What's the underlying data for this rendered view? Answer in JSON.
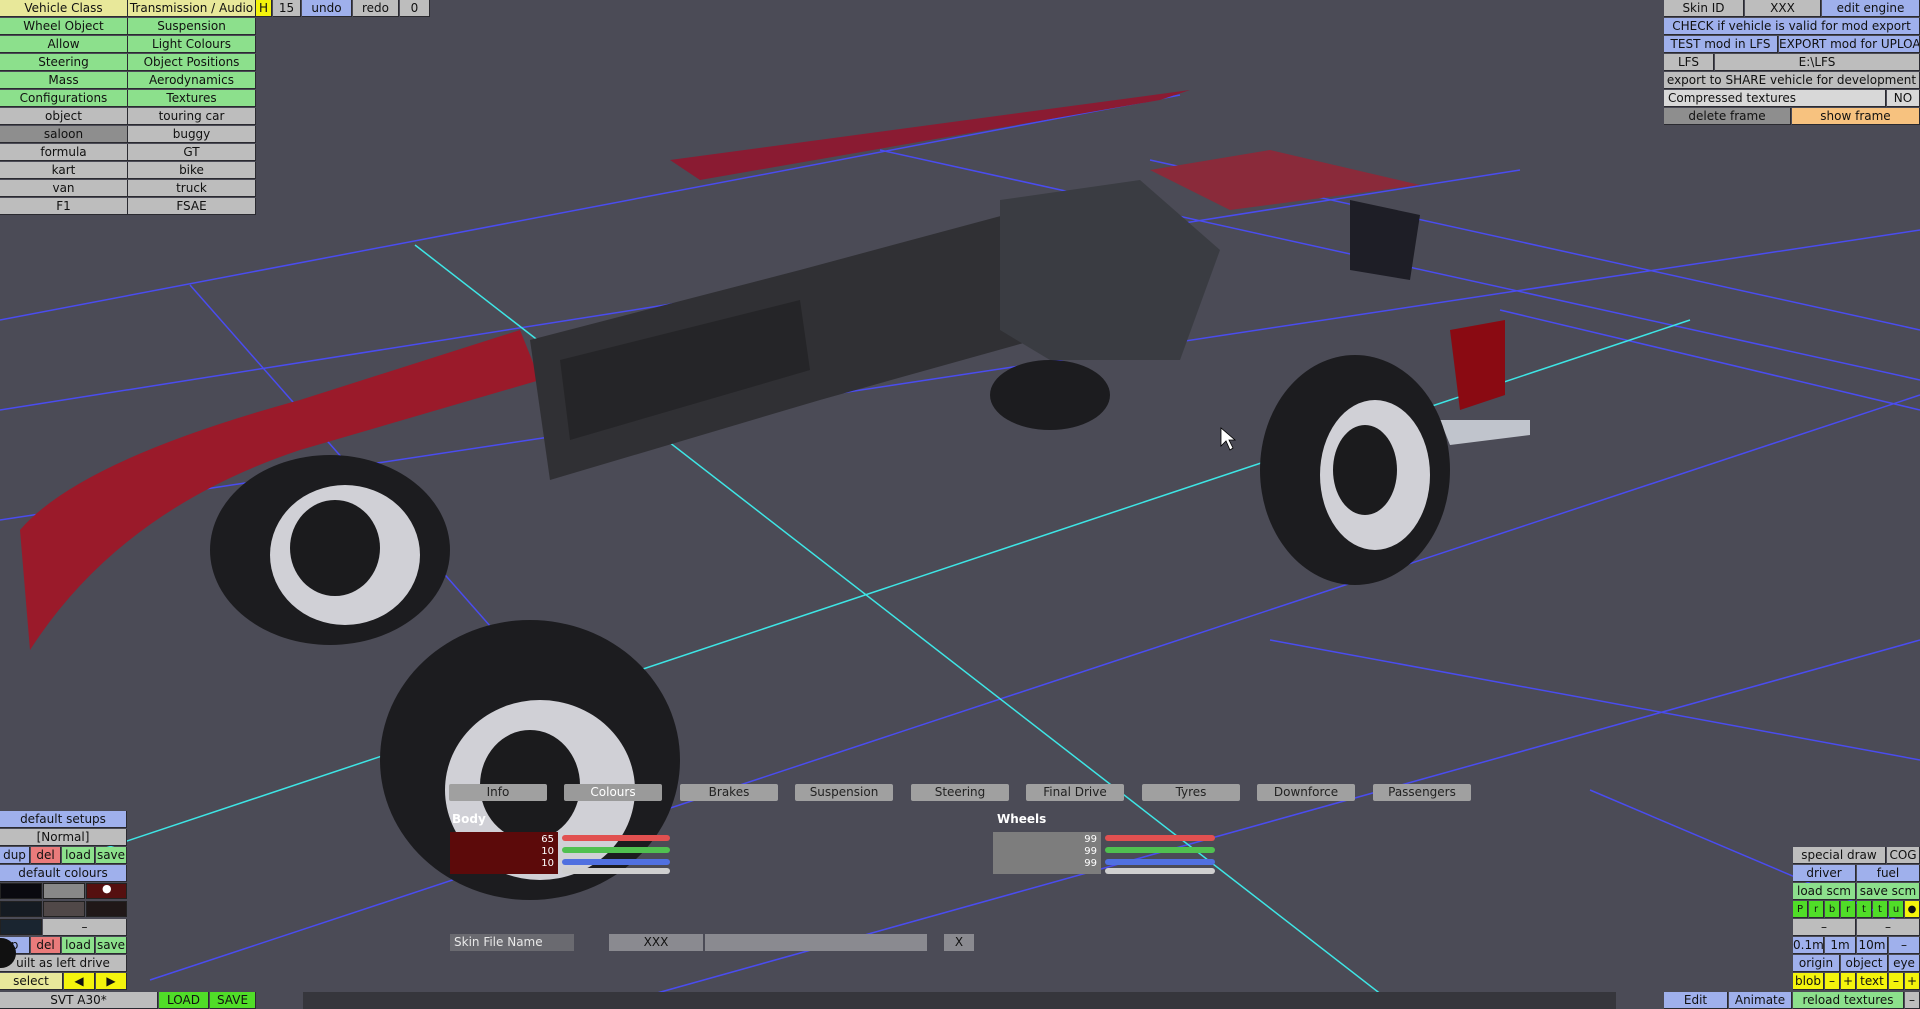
{
  "top_left_menu": {
    "col1": [
      "Vehicle Class",
      "Wheel Object",
      "Allow",
      "Steering",
      "Mass",
      "Configurations",
      "object",
      "saloon",
      "formula",
      "kart",
      "van",
      "F1"
    ],
    "col2": [
      "Transmission / Audio",
      "Suspension",
      "Light Colours",
      "Object Positions",
      "Aerodynamics",
      "Textures",
      "touring car",
      "buggy",
      "GT",
      "bike",
      "truck",
      "FSAE"
    ]
  },
  "top_toolbar": {
    "h_label": "H",
    "number": "15",
    "undo": "undo",
    "redo": "redo",
    "zero": "0"
  },
  "top_right": {
    "skin_id_label": "Skin ID",
    "skin_id_value": "XXX",
    "edit_engine": "edit engine",
    "check_valid": "CHECK if vehicle is valid for mod export",
    "test_mod": "TEST mod in LFS",
    "export_mod": "EXPORT mod for UPLOAD",
    "lfs_label": "LFS",
    "lfs_path": "E:\\LFS",
    "export_share": "export to SHARE vehicle for development",
    "compressed_label": "Compressed textures",
    "compressed_value": "NO",
    "delete_frame": "delete frame",
    "show_frame": "show frame"
  },
  "left_bottom": {
    "default_setups": "default setups",
    "normal": "[Normal]",
    "dup": "dup",
    "del": "del",
    "load": "load",
    "save": "save",
    "default_colours": "default colours",
    "dash": "–",
    "dup2": "p",
    "del2": "del",
    "load2": "load",
    "save2": "save",
    "built_left": "uilt as left drive",
    "select": "select",
    "prev": "◀",
    "next": "▶",
    "car_name": "SVT A30*",
    "load_btn": "LOAD",
    "save_btn": "SAVE",
    "colors": [
      "#0a0a10",
      "#888888",
      "#551010",
      "#151b22",
      "#504848",
      "#201818",
      "#1a2530"
    ]
  },
  "tabs": [
    "Info",
    "Colours",
    "Brakes",
    "Suspension",
    "Steering",
    "Final Drive",
    "Tyres",
    "Downforce",
    "Passengers"
  ],
  "colours_panel": {
    "body_label": "Body",
    "body_values": [
      "65",
      "10",
      "10"
    ],
    "body_color": "#5c0a0a",
    "wheels_label": "Wheels",
    "wheels_values": [
      "99",
      "99",
      "99"
    ],
    "wheels_color": "#7d7d7d",
    "skin_file_label": "Skin File Name",
    "skin_file_value": "XXX",
    "close": "X"
  },
  "bottom_right": {
    "special_draw": "special draw",
    "cog": "COG",
    "driver": "driver",
    "fuel": "fuel",
    "load_scm": "load scm",
    "save_scm": "save scm",
    "prb": [
      "P",
      "r",
      "b",
      "r",
      "t",
      "t",
      "u",
      "●"
    ],
    "dash1": "–",
    "dash2": "–",
    "scale": [
      "0.1m",
      "1m",
      "10m",
      "–"
    ],
    "origin": "origin",
    "object": "object",
    "eye": "eye",
    "blob": "blob",
    "minus": "–",
    "plus": "+",
    "text": "text",
    "minus2": "–",
    "plus2": "+",
    "edit": "Edit",
    "animate": "Animate",
    "reload_textures": "reload textures",
    "last_minus": "–"
  }
}
